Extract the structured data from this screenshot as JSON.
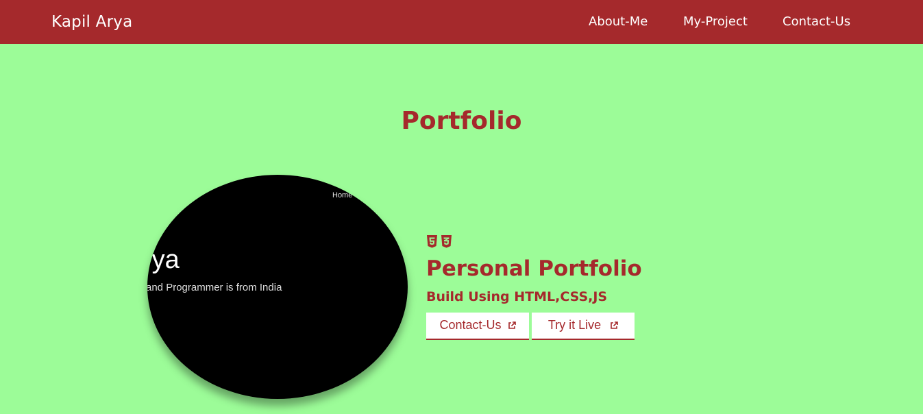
{
  "navbar": {
    "brand": "Kapil Arya",
    "links": [
      "About-Me",
      "My-Project",
      "Contact-Us"
    ]
  },
  "section": {
    "title": "Portfolio"
  },
  "project": {
    "preview": {
      "nav_home": "Home",
      "name_fragment": "rya",
      "tagline_fragment": "and Programmer is from India"
    },
    "tech_icons": [
      "html5-icon",
      "css3-icon"
    ],
    "title": "Personal Portfolio",
    "subtitle": "Build Using HTML,CSS,JS",
    "buttons": {
      "contact_label": "Contact-Us",
      "live_label": "Try it Live"
    }
  },
  "colors": {
    "background": "#9cfc98",
    "accent": "#a5292c",
    "preview_bg": "#000000",
    "button_bg": "#ffffff"
  }
}
